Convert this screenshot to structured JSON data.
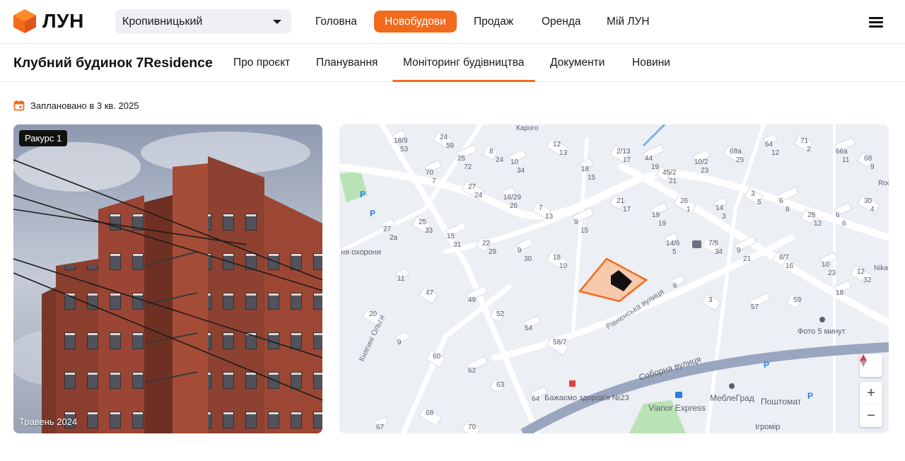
{
  "brand": {
    "name": "ЛУН",
    "accent": "#f26b1d"
  },
  "city_select": {
    "value": "Кропивницький"
  },
  "main_nav": [
    {
      "label": "Головна",
      "active": false
    },
    {
      "label": "Новобудови",
      "active": true
    },
    {
      "label": "Продаж",
      "active": false
    },
    {
      "label": "Оренда",
      "active": false
    },
    {
      "label": "Мій ЛУН",
      "active": false
    }
  ],
  "project": {
    "title": "Клубний будинок 7Residence",
    "tabs": [
      {
        "label": "Про проєкт",
        "active": false
      },
      {
        "label": "Планування",
        "active": false
      },
      {
        "label": "Моніторинг будівництва",
        "active": true
      },
      {
        "label": "Документи",
        "active": false
      },
      {
        "label": "Новини",
        "active": false
      }
    ]
  },
  "planned_text": "Заплановано в 3 кв. 2025",
  "photo": {
    "angle_badge": "Ракурс 1",
    "date_caption": "Травень 2024"
  },
  "map": {
    "street_labels": [
      "Рівненська вулиця",
      "Соборна вулиця",
      "Княгині Ольги"
    ],
    "poi_labels": [
      "Фото 5 минут",
      "МеблеГрад",
      "Поштомат",
      "Vianor Express",
      "Бажаємо здоров'я №23",
      "Ігромір",
      "ня охорони",
      "Карого",
      "Nika",
      "Roo"
    ],
    "house_numbers": [
      "18/9",
      "24",
      "25",
      "8",
      "10",
      "12",
      "18",
      "2/13",
      "44",
      "45/2",
      "10/2",
      "68а",
      "64",
      "71",
      "66а",
      "68",
      "70",
      "27",
      "16/29",
      "7",
      "9",
      "21",
      "19",
      "26",
      "14",
      "3",
      "6",
      "28",
      "6",
      "30",
      "27",
      "25",
      "15",
      "22",
      "9",
      "18",
      "14/6",
      "7/5",
      "9",
      "8/7",
      "10",
      "12",
      "11",
      "47",
      "49",
      "52",
      "54",
      "58/7",
      "6",
      "3",
      "57",
      "59",
      "18",
      "20",
      "9",
      "60",
      "62",
      "63",
      "64",
      "68",
      "67",
      "70",
      "53",
      "59",
      "72",
      "24",
      "34",
      "13",
      "15",
      "17",
      "19",
      "21",
      "23",
      "25",
      "12",
      "2",
      "11",
      "9",
      "7",
      "24",
      "26",
      "13",
      "15",
      "17",
      "19",
      "1",
      "3",
      "5",
      "8",
      "12",
      "6",
      "4",
      "2а",
      "33",
      "31",
      "29",
      "30",
      "10",
      "5",
      "34",
      "21",
      "16",
      "23",
      "32"
    ],
    "zoom_in": "+",
    "zoom_out": "−",
    "compass": "north-arrow"
  }
}
